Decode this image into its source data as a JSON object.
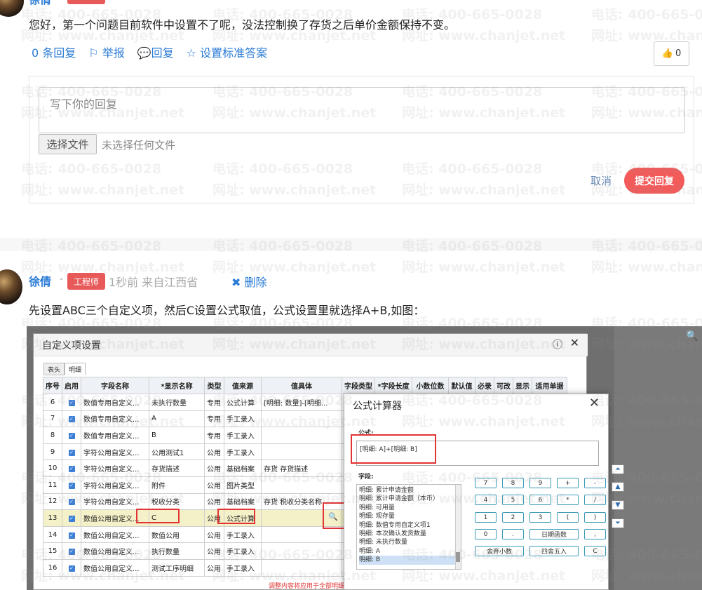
{
  "top_post": {
    "author_partial": "徐倩",
    "text": "您好，第一个问题目前软件中设置不了呢，没法控制换了存货之后单价金额保持不变。",
    "actions": [
      "0 条回复",
      "举报",
      "回复",
      "设置标准答案"
    ],
    "like_count": "0"
  },
  "reply_form": {
    "placeholder": "写下你的回复",
    "file_button": "选择文件",
    "file_status": "未选择任何文件",
    "cancel": "取消",
    "submit": "提交回复"
  },
  "comment": {
    "author": "徐倩",
    "dash": "-",
    "badge": "工程师",
    "meta": "1秒前 来自江西省",
    "delete": "删除",
    "text": "先设置ABC三个自定义项，然后C设置公式取值，公式设置里就选择A+B,如图："
  },
  "watermark": {
    "phone": "电话: 400-665-0028",
    "site": "网址: www.chanjet.net"
  },
  "screenshot": {
    "dialog_title": "自定义项设置",
    "tabs": [
      "表头",
      "明细"
    ],
    "columns": [
      "序号",
      "启用",
      "字段名称",
      "*显示名称",
      "类型",
      "值来源",
      "值具体",
      "字段类型",
      "*字段长度",
      "小数位数",
      "默认值",
      "必录",
      "可改",
      "显示",
      "适用单据"
    ],
    "rows": [
      {
        "no": "6",
        "field": "数值专用自定义...",
        "display": "未执行数量",
        "type": "专用",
        "source": "公式计算",
        "value": "[明细: 数量]-[明细..."
      },
      {
        "no": "7",
        "field": "数值专用自定义...",
        "display": "A",
        "type": "专用",
        "source": "手工录入",
        "value": ""
      },
      {
        "no": "8",
        "field": "数值专用自定义...",
        "display": "B",
        "type": "专用",
        "source": "手工录入",
        "value": ""
      },
      {
        "no": "9",
        "field": "字符公用自定义...",
        "display": "公用测试1",
        "type": "公用",
        "source": "手工录入",
        "value": ""
      },
      {
        "no": "10",
        "field": "字符公用自定义...",
        "display": "存货描述",
        "type": "公用",
        "source": "基础档案",
        "value": "存货 存货描述"
      },
      {
        "no": "11",
        "field": "字符公用自定义...",
        "display": "附件",
        "type": "公用",
        "source": "图片类型",
        "value": ""
      },
      {
        "no": "12",
        "field": "字符公用自定义...",
        "display": "税收分类",
        "type": "公用",
        "source": "基础档案",
        "value": "存货 税收分类名称"
      },
      {
        "no": "13",
        "field": "数值公用自定义...",
        "display": "C",
        "type": "公用",
        "source": "公式计算",
        "value": ""
      },
      {
        "no": "14",
        "field": "数值公用自定义...",
        "display": "数值公用",
        "type": "公用",
        "source": "手工录入",
        "value": ""
      },
      {
        "no": "15",
        "field": "数值公用自定义...",
        "display": "执行数量",
        "type": "公用",
        "source": "手工录入",
        "value": ""
      },
      {
        "no": "16",
        "field": "数值公用自定义...",
        "display": "测试工序明细",
        "type": "公用",
        "source": "手工录入",
        "value": ""
      }
    ],
    "calc": {
      "title": "公式计算器",
      "formula_label": "公式:",
      "formula": "[明细: A]+[明细: B]",
      "fields_label": "字段:",
      "fields": [
        "明细: 累计申请金额",
        "明细: 累计申请金额（本币）",
        "明细: 可用量",
        "明细: 现存量",
        "明细: 数值专用自定义项1",
        "明细: 本次确认发货数量",
        "明细: 未执行数量",
        "明细: A",
        "明细: B"
      ],
      "keys": [
        "7",
        "8",
        "9",
        "+",
        "-",
        "4",
        "5",
        "6",
        "*",
        "/",
        "1",
        "2",
        "3",
        "(",
        ")",
        "0",
        ".",
        "日期函数",
        ",",
        "舍弃小数",
        "四舍五入",
        "C"
      ]
    },
    "bottom_hint": "调整内容将应用于全部明细"
  }
}
